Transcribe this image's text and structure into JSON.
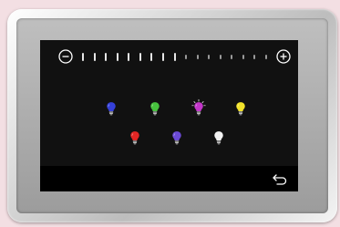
{
  "brightness": {
    "level_fraction": 0.5,
    "decrease_icon": "minus-circle-icon",
    "increase_icon": "plus-circle-icon"
  },
  "bulbs": [
    {
      "name": "blue",
      "color": "#3540d8",
      "active": false
    },
    {
      "name": "green",
      "color": "#47c23e",
      "active": false
    },
    {
      "name": "magenta",
      "color": "#c236c9",
      "active": true
    },
    {
      "name": "yellow",
      "color": "#f2e22a",
      "active": false
    },
    {
      "name": "red",
      "color": "#e32624",
      "active": false
    },
    {
      "name": "purple",
      "color": "#6b4ad6",
      "active": false
    },
    {
      "name": "white",
      "color": "#f2f2f2",
      "active": false
    }
  ],
  "navigation": {
    "back_icon": "back-arrow-icon"
  }
}
